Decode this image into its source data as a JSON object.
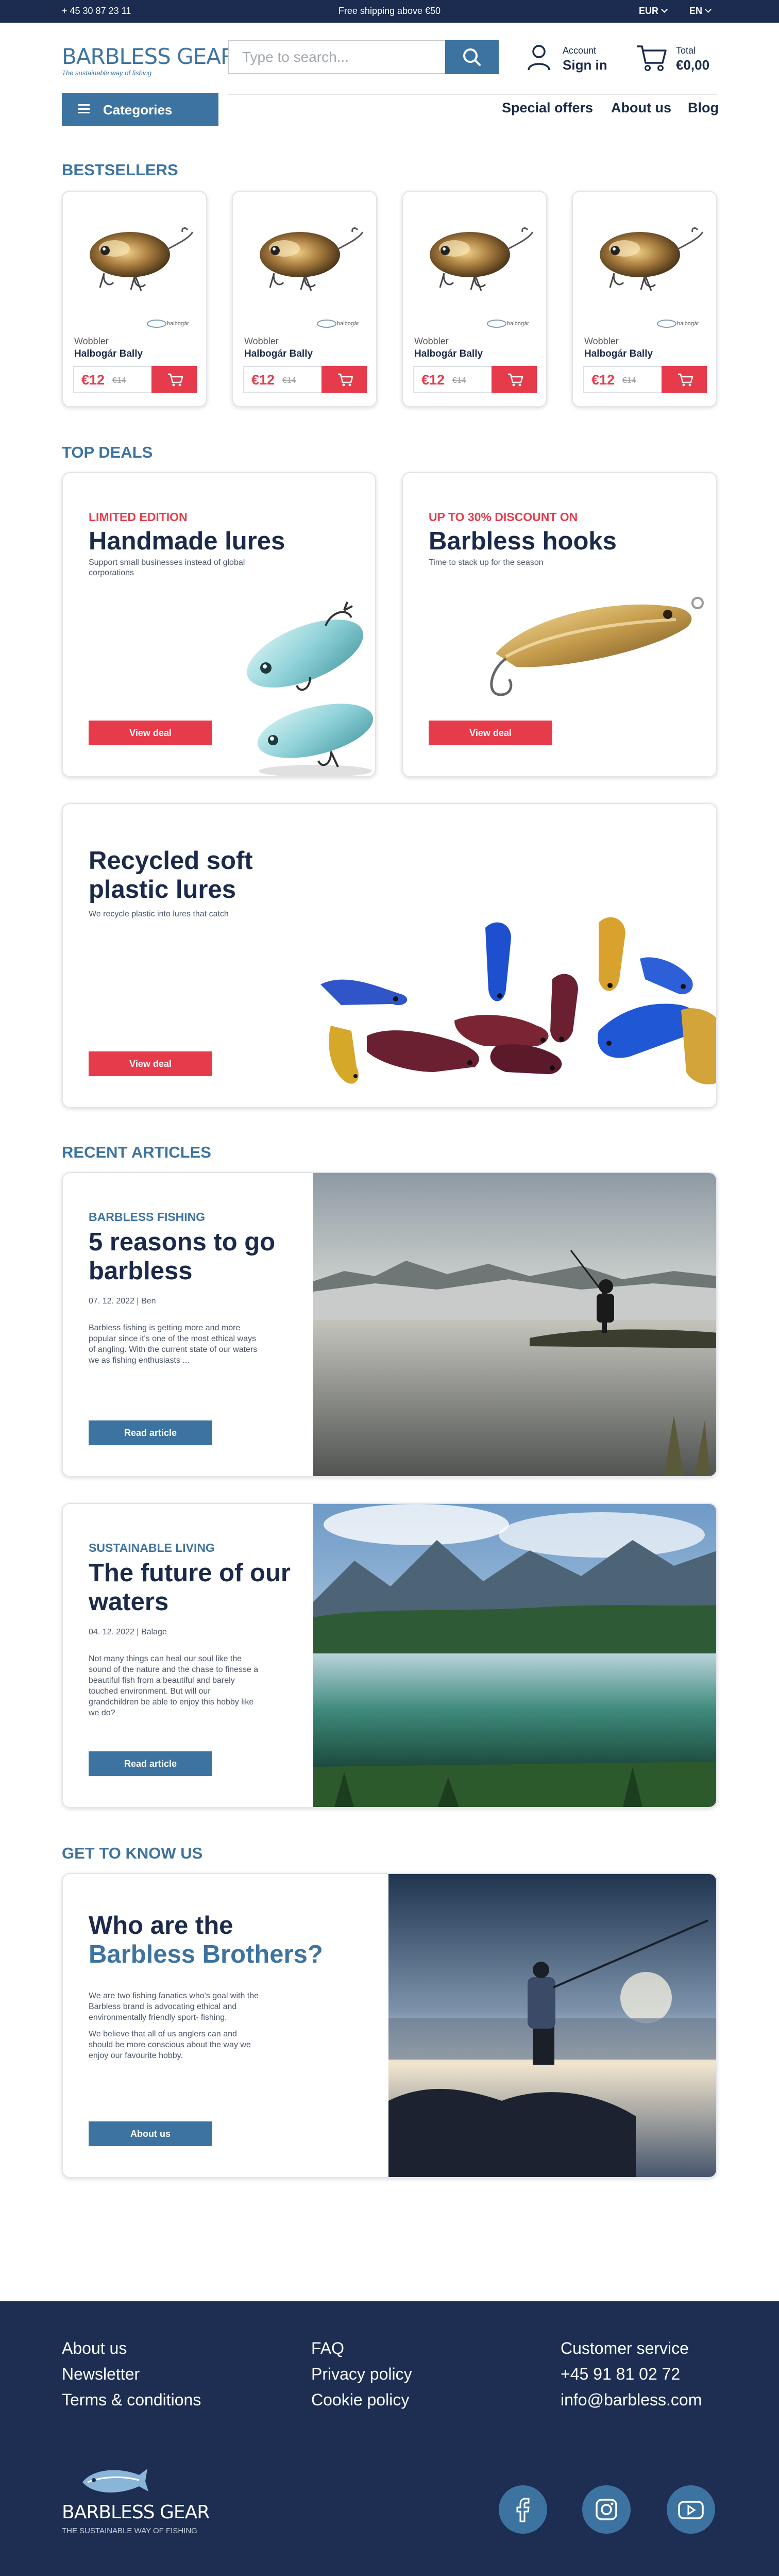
{
  "topbar": {
    "phone": "+ 45 30 87 23 11",
    "shipping": "Free shipping above €50",
    "currency": "EUR",
    "language": "EN"
  },
  "header": {
    "logo_name": "BARBLESS GEAR",
    "logo_tagline": "The sustainable way of fishing",
    "search_placeholder": "Type to search...",
    "account_small": "Account",
    "account_big": "Sign in",
    "cart_small": "Total",
    "cart_total": "€0,00"
  },
  "nav": {
    "categories": "Categories",
    "special_offers": "Special offers",
    "about_us": "About us",
    "blog": "Blog"
  },
  "bestsellers": {
    "heading": "BESTSELLERS",
    "products": [
      {
        "type": "Wobbler",
        "name": "Halbogár Bally",
        "brand": "halbogár",
        "price": "€12",
        "old_price": "€14"
      },
      {
        "type": "Wobbler",
        "name": "Halbogár Bally",
        "brand": "halbogár",
        "price": "€12",
        "old_price": "€14"
      },
      {
        "type": "Wobbler",
        "name": "Halbogár Bally",
        "brand": "halbogár",
        "price": "€12",
        "old_price": "€14"
      },
      {
        "type": "Wobbler",
        "name": "Halbogár Bally",
        "brand": "halbogár",
        "price": "€12",
        "old_price": "€14"
      }
    ]
  },
  "top_deals": {
    "heading": "TOP DEALS",
    "deal1": {
      "eyebrow": "LIMITED EDITION",
      "title": "Handmade lures",
      "sub": "Support small businesses instead of global corporations",
      "cta": "View deal"
    },
    "deal2": {
      "eyebrow": "UP TO 30% DISCOUNT ON",
      "title": "Barbless hooks",
      "sub": "Time to stack up for the season",
      "cta": "View deal"
    },
    "deal3": {
      "title_line1": "Recycled soft",
      "title_line2": "plastic lures",
      "sub": "We recycle plastic into lures that catch",
      "cta": "View deal"
    }
  },
  "articles": {
    "heading": "RECENT ARTICLES",
    "a1": {
      "eyebrow": "BARBLESS FISHING",
      "title_line1": "5 reasons to go",
      "title_line2": "barbless",
      "date": "07. 12. 2022",
      "author": "Ben",
      "body": [
        "Barbless fishing is getting more and more",
        "popular since it's one of the most ethical ways",
        "of angling. With the current state of our waters",
        "we as fishing enthusiasts ..."
      ],
      "cta": "Read article"
    },
    "a2": {
      "eyebrow": "SUSTAINABLE LIVING",
      "title_line1": "The future of our",
      "title_line2": "waters",
      "date": "04. 12. 2022",
      "author": "Balage",
      "body": [
        "Not many things can heal our soul like the",
        "sound of the nature and the chase to finesse a",
        "beautiful fish from a beautiful and barely",
        "touched environment. But will our",
        "grandchildren be able to enjoy this hobby like",
        "we do?"
      ],
      "cta": "Read article"
    }
  },
  "about": {
    "heading": "GET TO KNOW US",
    "title_line1": "Who are the",
    "title_line2": "Barbless Brothers?",
    "p1": [
      "We are two fishing fanatics who's goal with the",
      "Barbless brand is advocating ethical and",
      "environmentally friendly sport- fishing."
    ],
    "p2": [
      "We believe that all of us anglers can and",
      "should be more conscious about the way we",
      "enjoy our favourite hobby."
    ],
    "cta": "About us"
  },
  "footer": {
    "col1": [
      "About us",
      "Newsletter",
      "Terms & conditions"
    ],
    "col2": [
      "FAQ",
      "Privacy policy",
      "Cookie policy"
    ],
    "col3": [
      "Customer service",
      "+45 91 81 02 72",
      "info@barbless.com"
    ],
    "logo_name": "BARBLESS GEAR",
    "logo_tagline": "THE SUSTAINABLE WAY OF FISHING",
    "social_icons": [
      "facebook-icon",
      "instagram-icon",
      "youtube-icon"
    ]
  },
  "colors": {
    "navy": "#1b2c50",
    "blue": "#3d73a0",
    "red": "#e63b4b",
    "footer": "#1d2e52"
  }
}
